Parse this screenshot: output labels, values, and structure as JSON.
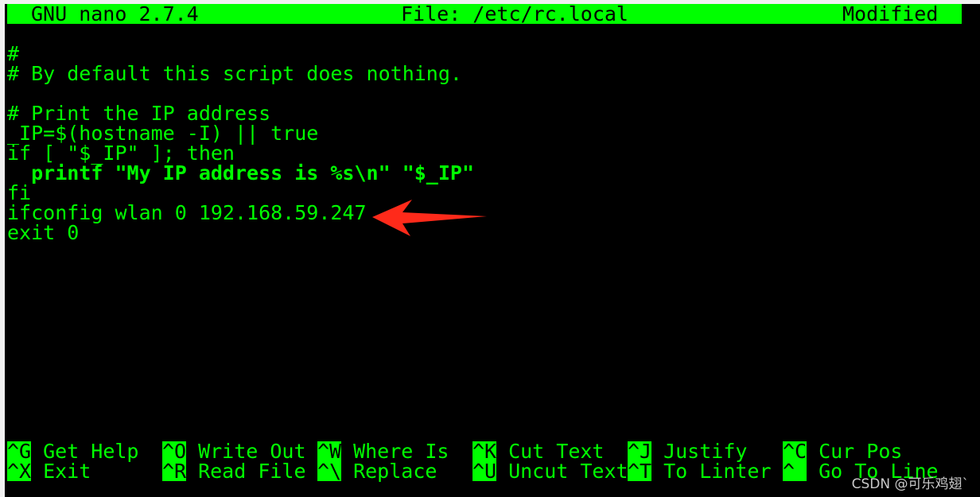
{
  "titlebar": {
    "app": "GNU nano 2.7.4",
    "file": "File: /etc/rc.local",
    "status": "Modified"
  },
  "editor": {
    "lines": [
      "",
      "#",
      "# By default this script does nothing.",
      "",
      "# Print the IP address",
      "_IP=$(hostname -I) || true",
      "if [ \"$_IP\" ]; then",
      "  printf \"My IP address is %s\\n\" \"$_IP\"",
      "fi",
      "ifconfig wlan 0 192.168.59.247",
      "exit 0"
    ]
  },
  "annotation": {
    "icon": "red-arrow-icon",
    "color": "#ff2a1a"
  },
  "shortcuts": [
    {
      "key": "^G",
      "label": "Get Help"
    },
    {
      "key": "^O",
      "label": "Write Out"
    },
    {
      "key": "^W",
      "label": "Where Is"
    },
    {
      "key": "^K",
      "label": "Cut Text"
    },
    {
      "key": "^J",
      "label": "Justify"
    },
    {
      "key": "^C",
      "label": "Cur Pos"
    },
    {
      "key": "^X",
      "label": "Exit"
    },
    {
      "key": "^R",
      "label": "Read File"
    },
    {
      "key": "^\\",
      "label": "Replace"
    },
    {
      "key": "^U",
      "label": "Uncut Text"
    },
    {
      "key": "^T",
      "label": "To Linter"
    },
    {
      "key": "^_",
      "label": "Go To Line"
    }
  ],
  "watermark": "CSDN @可乐鸡翅`",
  "colors": {
    "fg": "#00ff00",
    "bg": "#000000"
  }
}
